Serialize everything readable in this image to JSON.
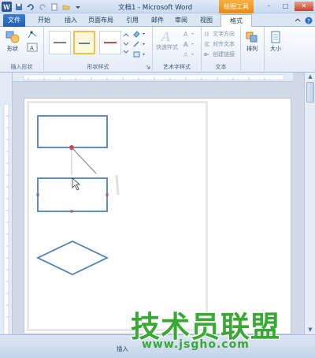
{
  "window": {
    "title": "文档1 - Microsoft Word",
    "context_tab": "绘图工具",
    "minimize": "–",
    "restore": "□",
    "close": "✕"
  },
  "qat": {
    "logo": "W",
    "save_icon": "save-icon",
    "undo_icon": "undo-icon",
    "redo_icon": "redo-icon"
  },
  "tabs": [
    {
      "label": "文件"
    },
    {
      "label": "开始"
    },
    {
      "label": "插入"
    },
    {
      "label": "页面布局"
    },
    {
      "label": "引用"
    },
    {
      "label": "邮件"
    },
    {
      "label": "审阅"
    },
    {
      "label": "视图"
    },
    {
      "label": "格式"
    }
  ],
  "ribbon": {
    "groups": {
      "insert_shapes": "插入形状",
      "shape_styles": "形状样式",
      "wordart_styles": "艺术字样式",
      "text": "文本"
    },
    "shapes_button": "形状",
    "quick_styles": "快速样式",
    "text_direction": "文字方向",
    "align_text": "对齐文本",
    "create_link": "创建链接",
    "arrange": "排列",
    "size": "大小",
    "colors": {
      "style1": "#7f7f7f",
      "style2": "#4f81bd",
      "style3": "#c0504d"
    }
  },
  "status": {
    "mode": "插入"
  },
  "watermark": {
    "text": "技术员联盟",
    "url": "www.jsgho.com"
  }
}
